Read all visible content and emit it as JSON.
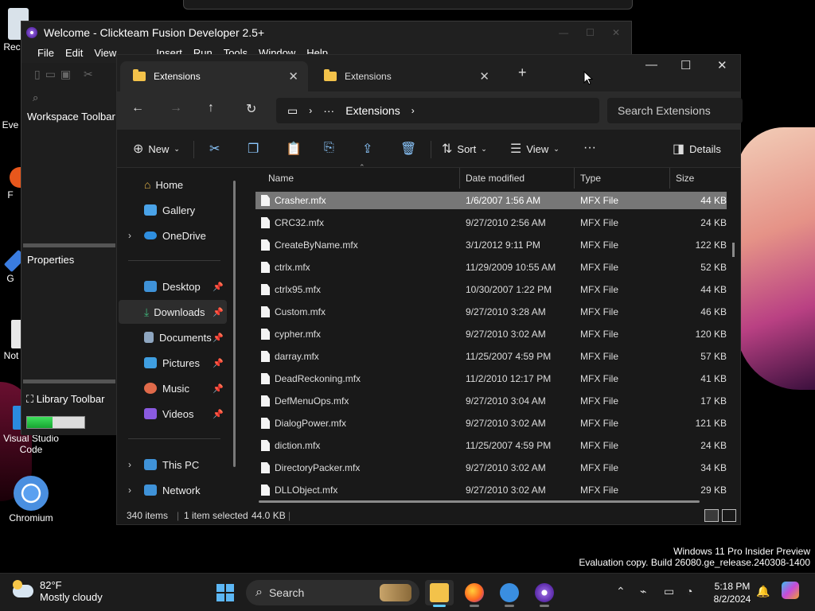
{
  "desktop": {
    "icons": [
      {
        "label": "Rec"
      },
      {
        "label": "Eve"
      },
      {
        "label": "F"
      },
      {
        "label": "G"
      },
      {
        "label": "Not"
      },
      {
        "label": "Visual Studio Code"
      },
      {
        "label": "Chromium"
      }
    ],
    "watermark_line1": "Windows 11 Pro Insider Preview",
    "watermark_line2": "Evaluation copy. Build 26080.ge_release.240308-1400"
  },
  "clickteam": {
    "title": "Welcome - Clickteam Fusion Developer 2.5+",
    "menu": [
      "File",
      "Edit",
      "View",
      "Insert",
      "Run",
      "Tools",
      "Window",
      "Help"
    ],
    "workspace_toolbar": "Workspace Toolbar",
    "properties": "Properties",
    "library_toolbar": "Library Toolbar",
    "progress": 0.45
  },
  "explorer": {
    "tabs": [
      {
        "label": "Extensions",
        "active": true
      },
      {
        "label": "Extensions",
        "active": false
      }
    ],
    "new_tab": "+",
    "address": {
      "ellipsis": "···",
      "crumb": "Extensions"
    },
    "search_placeholder": "Search Extensions",
    "commands": {
      "new": "New",
      "sort": "Sort",
      "view": "View",
      "more": "···",
      "details": "Details"
    },
    "nav": [
      {
        "label": "Home",
        "icon": "home-icon",
        "color": "#e8b64a"
      },
      {
        "label": "Gallery",
        "icon": "gallery-icon",
        "color": "#4aa3e8"
      },
      {
        "label": "OneDrive",
        "icon": "onedrive-icon",
        "color": "#2f8fe0"
      },
      {
        "label": "Desktop",
        "icon": "desktop-icon",
        "color": "#3f92d8"
      },
      {
        "label": "Downloads",
        "icon": "downloads-icon",
        "color": "#3fb47a"
      },
      {
        "label": "Documents",
        "icon": "documents-icon",
        "color": "#8ea6c0"
      },
      {
        "label": "Pictures",
        "icon": "pictures-icon",
        "color": "#3f9ee0"
      },
      {
        "label": "Music",
        "icon": "music-icon",
        "color": "#e06a4a"
      },
      {
        "label": "Videos",
        "icon": "videos-icon",
        "color": "#8a5ae0"
      },
      {
        "label": "This PC",
        "icon": "pc-icon",
        "color": "#3f92d8"
      },
      {
        "label": "Network",
        "icon": "network-icon",
        "color": "#3f92d8"
      }
    ],
    "columns": {
      "name": "Name",
      "date": "Date modified",
      "type": "Type",
      "size": "Size"
    },
    "files": [
      {
        "name": "Crasher.mfx",
        "date": "1/6/2007 1:56 AM",
        "type": "MFX File",
        "size": "44 KB"
      },
      {
        "name": "CRC32.mfx",
        "date": "9/27/2010 2:56 AM",
        "type": "MFX File",
        "size": "24 KB"
      },
      {
        "name": "CreateByName.mfx",
        "date": "3/1/2012 9:11 PM",
        "type": "MFX File",
        "size": "122 KB"
      },
      {
        "name": "ctrlx.mfx",
        "date": "11/29/2009 10:55 AM",
        "type": "MFX File",
        "size": "52 KB"
      },
      {
        "name": "ctrlx95.mfx",
        "date": "10/30/2007 1:22 PM",
        "type": "MFX File",
        "size": "44 KB"
      },
      {
        "name": "Custom.mfx",
        "date": "9/27/2010 3:28 AM",
        "type": "MFX File",
        "size": "46 KB"
      },
      {
        "name": "cypher.mfx",
        "date": "9/27/2010 3:02 AM",
        "type": "MFX File",
        "size": "120 KB"
      },
      {
        "name": "darray.mfx",
        "date": "11/25/2007 4:59 PM",
        "type": "MFX File",
        "size": "57 KB"
      },
      {
        "name": "DeadReckoning.mfx",
        "date": "11/2/2010 12:17 PM",
        "type": "MFX File",
        "size": "41 KB"
      },
      {
        "name": "DefMenuOps.mfx",
        "date": "9/27/2010 3:04 AM",
        "type": "MFX File",
        "size": "17 KB"
      },
      {
        "name": "DialogPower.mfx",
        "date": "9/27/2010 3:02 AM",
        "type": "MFX File",
        "size": "121 KB"
      },
      {
        "name": "diction.mfx",
        "date": "11/25/2007 4:59 PM",
        "type": "MFX File",
        "size": "24 KB"
      },
      {
        "name": "DirectoryPacker.mfx",
        "date": "9/27/2010 3:02 AM",
        "type": "MFX File",
        "size": "34 KB"
      },
      {
        "name": "DLLObject.mfx",
        "date": "9/27/2010 3:02 AM",
        "type": "MFX File",
        "size": "29 KB"
      }
    ],
    "status": {
      "items": "340 items",
      "selected": "1 item selected",
      "size": "44.0 KB"
    }
  },
  "taskbar": {
    "temp": "82°F",
    "weather": "Mostly cloudy",
    "search": "Search",
    "time": "5:18 PM",
    "date": "8/2/2024"
  }
}
